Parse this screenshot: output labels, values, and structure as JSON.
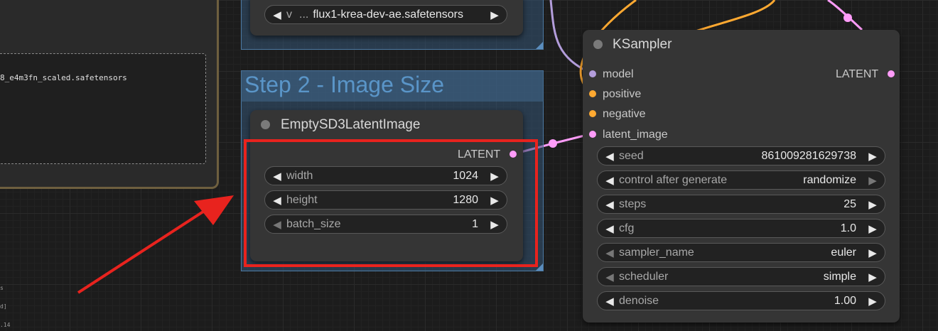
{
  "note": {
    "text": "8_e4m3fn_scaled.safetensors",
    "side_labels": [
      "s",
      "d]",
      ".14"
    ]
  },
  "vae_loader": {
    "widget": {
      "prefix": "v",
      "ellipsis": "...",
      "value": "flux1-krea-dev-ae.safetensors"
    }
  },
  "group": {
    "title": "Step 2 - Image Size"
  },
  "latent_node": {
    "title": "EmptySD3LatentImage",
    "output_label": "LATENT",
    "widgets": [
      {
        "label": "width",
        "value": "1024"
      },
      {
        "label": "height",
        "value": "1280"
      },
      {
        "label": "batch_size",
        "value": "1"
      }
    ]
  },
  "ksampler": {
    "title": "KSampler",
    "inputs": [
      {
        "label": "model",
        "color": "#b39ddb"
      },
      {
        "label": "positive",
        "color": "#ffa931"
      },
      {
        "label": "negative",
        "color": "#ffa931"
      },
      {
        "label": "latent_image",
        "color": "#ff9cf9"
      }
    ],
    "output_label": "LATENT",
    "widgets": [
      {
        "label": "seed",
        "value": "861009281629738"
      },
      {
        "label": "control after generate",
        "value": "randomize"
      },
      {
        "label": "steps",
        "value": "25"
      },
      {
        "label": "cfg",
        "value": "1.0"
      },
      {
        "label": "sampler_name",
        "value": "euler"
      },
      {
        "label": "scheduler",
        "value": "simple"
      },
      {
        "label": "denoise",
        "value": "1.00"
      }
    ]
  },
  "colors": {
    "latent_link": "#ff9cf9",
    "conditioning_link": "#ffa931",
    "model_link": "#b39ddb",
    "highlight": "#e8231e"
  },
  "icons": {
    "left_arrow": "◀",
    "right_arrow": "▶"
  }
}
